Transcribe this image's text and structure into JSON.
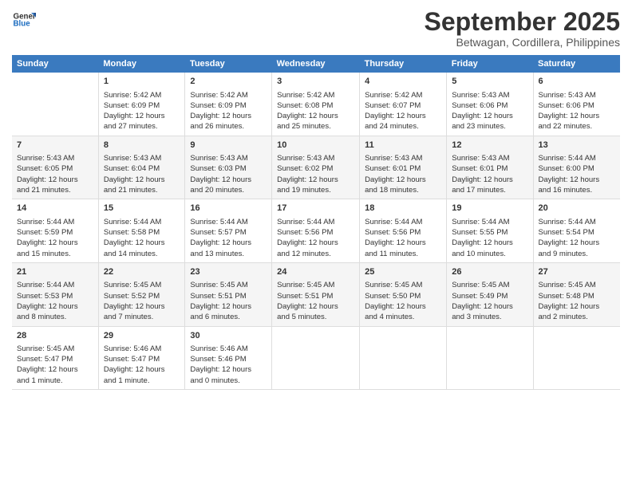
{
  "logo": {
    "line1": "General",
    "line2": "Blue"
  },
  "title": "September 2025",
  "subtitle": "Betwagan, Cordillera, Philippines",
  "days_of_week": [
    "Sunday",
    "Monday",
    "Tuesday",
    "Wednesday",
    "Thursday",
    "Friday",
    "Saturday"
  ],
  "weeks": [
    [
      {
        "day": "",
        "info": ""
      },
      {
        "day": "1",
        "info": "Sunrise: 5:42 AM\nSunset: 6:09 PM\nDaylight: 12 hours\nand 27 minutes."
      },
      {
        "day": "2",
        "info": "Sunrise: 5:42 AM\nSunset: 6:09 PM\nDaylight: 12 hours\nand 26 minutes."
      },
      {
        "day": "3",
        "info": "Sunrise: 5:42 AM\nSunset: 6:08 PM\nDaylight: 12 hours\nand 25 minutes."
      },
      {
        "day": "4",
        "info": "Sunrise: 5:42 AM\nSunset: 6:07 PM\nDaylight: 12 hours\nand 24 minutes."
      },
      {
        "day": "5",
        "info": "Sunrise: 5:43 AM\nSunset: 6:06 PM\nDaylight: 12 hours\nand 23 minutes."
      },
      {
        "day": "6",
        "info": "Sunrise: 5:43 AM\nSunset: 6:06 PM\nDaylight: 12 hours\nand 22 minutes."
      }
    ],
    [
      {
        "day": "7",
        "info": "Sunrise: 5:43 AM\nSunset: 6:05 PM\nDaylight: 12 hours\nand 21 minutes."
      },
      {
        "day": "8",
        "info": "Sunrise: 5:43 AM\nSunset: 6:04 PM\nDaylight: 12 hours\nand 21 minutes."
      },
      {
        "day": "9",
        "info": "Sunrise: 5:43 AM\nSunset: 6:03 PM\nDaylight: 12 hours\nand 20 minutes."
      },
      {
        "day": "10",
        "info": "Sunrise: 5:43 AM\nSunset: 6:02 PM\nDaylight: 12 hours\nand 19 minutes."
      },
      {
        "day": "11",
        "info": "Sunrise: 5:43 AM\nSunset: 6:01 PM\nDaylight: 12 hours\nand 18 minutes."
      },
      {
        "day": "12",
        "info": "Sunrise: 5:43 AM\nSunset: 6:01 PM\nDaylight: 12 hours\nand 17 minutes."
      },
      {
        "day": "13",
        "info": "Sunrise: 5:44 AM\nSunset: 6:00 PM\nDaylight: 12 hours\nand 16 minutes."
      }
    ],
    [
      {
        "day": "14",
        "info": "Sunrise: 5:44 AM\nSunset: 5:59 PM\nDaylight: 12 hours\nand 15 minutes."
      },
      {
        "day": "15",
        "info": "Sunrise: 5:44 AM\nSunset: 5:58 PM\nDaylight: 12 hours\nand 14 minutes."
      },
      {
        "day": "16",
        "info": "Sunrise: 5:44 AM\nSunset: 5:57 PM\nDaylight: 12 hours\nand 13 minutes."
      },
      {
        "day": "17",
        "info": "Sunrise: 5:44 AM\nSunset: 5:56 PM\nDaylight: 12 hours\nand 12 minutes."
      },
      {
        "day": "18",
        "info": "Sunrise: 5:44 AM\nSunset: 5:56 PM\nDaylight: 12 hours\nand 11 minutes."
      },
      {
        "day": "19",
        "info": "Sunrise: 5:44 AM\nSunset: 5:55 PM\nDaylight: 12 hours\nand 10 minutes."
      },
      {
        "day": "20",
        "info": "Sunrise: 5:44 AM\nSunset: 5:54 PM\nDaylight: 12 hours\nand 9 minutes."
      }
    ],
    [
      {
        "day": "21",
        "info": "Sunrise: 5:44 AM\nSunset: 5:53 PM\nDaylight: 12 hours\nand 8 minutes."
      },
      {
        "day": "22",
        "info": "Sunrise: 5:45 AM\nSunset: 5:52 PM\nDaylight: 12 hours\nand 7 minutes."
      },
      {
        "day": "23",
        "info": "Sunrise: 5:45 AM\nSunset: 5:51 PM\nDaylight: 12 hours\nand 6 minutes."
      },
      {
        "day": "24",
        "info": "Sunrise: 5:45 AM\nSunset: 5:51 PM\nDaylight: 12 hours\nand 5 minutes."
      },
      {
        "day": "25",
        "info": "Sunrise: 5:45 AM\nSunset: 5:50 PM\nDaylight: 12 hours\nand 4 minutes."
      },
      {
        "day": "26",
        "info": "Sunrise: 5:45 AM\nSunset: 5:49 PM\nDaylight: 12 hours\nand 3 minutes."
      },
      {
        "day": "27",
        "info": "Sunrise: 5:45 AM\nSunset: 5:48 PM\nDaylight: 12 hours\nand 2 minutes."
      }
    ],
    [
      {
        "day": "28",
        "info": "Sunrise: 5:45 AM\nSunset: 5:47 PM\nDaylight: 12 hours\nand 1 minute."
      },
      {
        "day": "29",
        "info": "Sunrise: 5:46 AM\nSunset: 5:47 PM\nDaylight: 12 hours\nand 1 minute."
      },
      {
        "day": "30",
        "info": "Sunrise: 5:46 AM\nSunset: 5:46 PM\nDaylight: 12 hours\nand 0 minutes."
      },
      {
        "day": "",
        "info": ""
      },
      {
        "day": "",
        "info": ""
      },
      {
        "day": "",
        "info": ""
      },
      {
        "day": "",
        "info": ""
      }
    ]
  ]
}
